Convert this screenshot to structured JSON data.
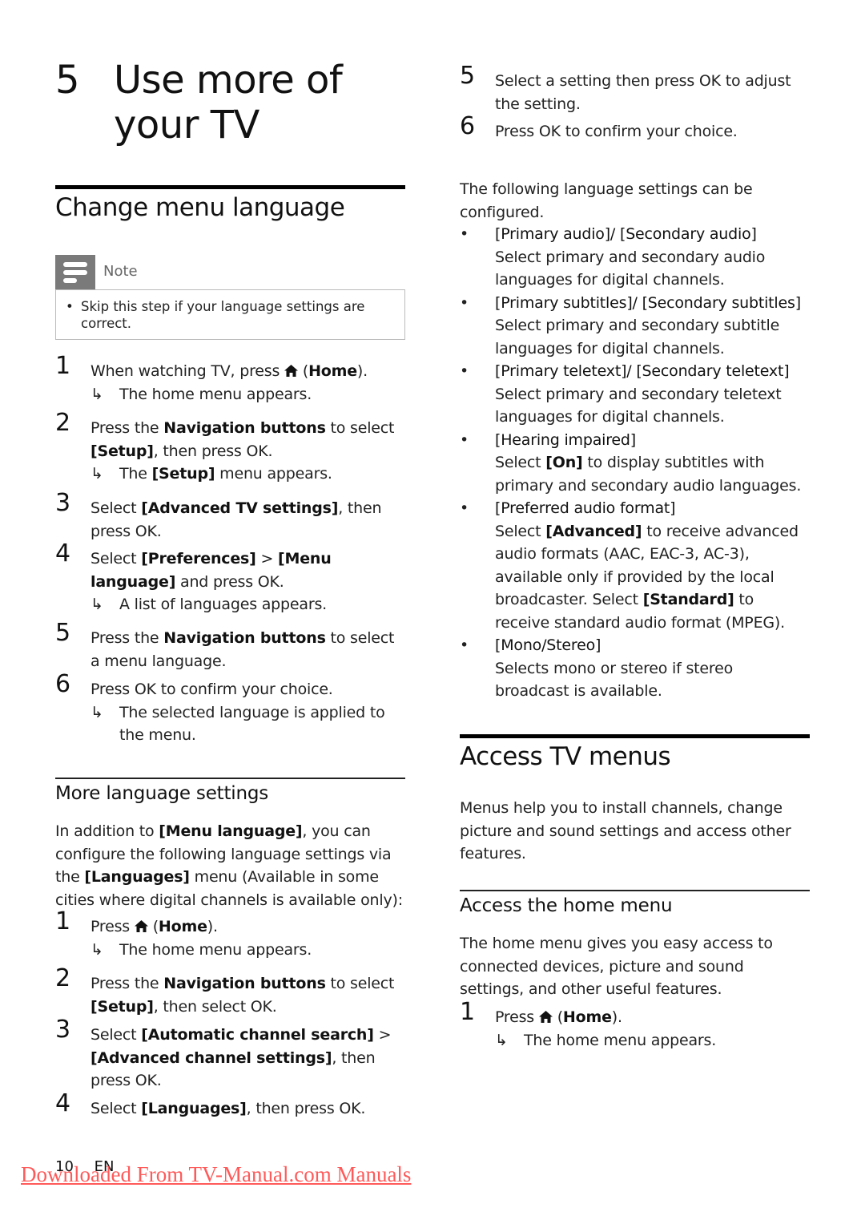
{
  "chapter": {
    "number": "5",
    "title_line1": "Use more of",
    "title_line2": "your TV"
  },
  "change_menu_language": {
    "heading": "Change menu language",
    "note": {
      "icon": "note-icon",
      "label": "Note",
      "bullet": "•",
      "text": "Skip this step if your language settings are correct."
    },
    "steps": [
      {
        "n": "1",
        "parts": [
          "When watching TV, press ",
          "⌂",
          " (",
          "Home",
          ")."
        ],
        "result": "The home menu appears."
      },
      {
        "n": "2",
        "parts": [
          "Press the ",
          "Navigation buttons",
          " to select ",
          "[Setup]",
          ", then press OK."
        ],
        "result_parts": [
          "The ",
          "[Setup]",
          " menu appears."
        ]
      },
      {
        "n": "3",
        "parts": [
          "Select ",
          "[Advanced TV settings]",
          ", then press OK."
        ]
      },
      {
        "n": "4",
        "parts": [
          "Select ",
          "[Preferences]",
          " > ",
          "[Menu language]",
          " and press OK."
        ],
        "result": "A list of languages appears."
      },
      {
        "n": "5",
        "parts": [
          "Press the ",
          "Navigation buttons",
          " to select a menu language."
        ]
      },
      {
        "n": "6",
        "parts": [
          "Press OK to confirm your choice."
        ],
        "result": "The selected language is applied to the menu."
      }
    ]
  },
  "more_language_settings": {
    "heading": "More language settings",
    "intro": [
      "In addition to ",
      "[Menu language]",
      ", you can configure the following language settings via the ",
      "[Languages]",
      " menu (Available in some cities where digital channels is available only):"
    ],
    "steps": [
      {
        "n": "1",
        "parts": [
          "Press ",
          "⌂",
          " (",
          "Home",
          ")."
        ],
        "result": "The home menu appears."
      },
      {
        "n": "2",
        "parts": [
          "Press the ",
          "Navigation buttons",
          " to select ",
          "[Setup]",
          ", then select OK."
        ]
      },
      {
        "n": "3",
        "parts": [
          "Select ",
          "[Automatic channel search]",
          " > ",
          "[Advanced channel settings]",
          ", then press OK."
        ]
      },
      {
        "n": "4",
        "parts": [
          "Select ",
          "[Languages]",
          ", then press OK."
        ]
      },
      {
        "n": "5",
        "parts": [
          "Select a setting then press OK to adjust the setting."
        ]
      },
      {
        "n": "6",
        "parts": [
          "Press OK to confirm your choice."
        ]
      }
    ],
    "following_text": "The following language settings can be configured.",
    "options": [
      {
        "title": "[Primary audio]/ [Secondary audio]",
        "desc": [
          "Select primary and secondary audio languages for digital channels."
        ]
      },
      {
        "title": "[Primary subtitles]/ [Secondary subtitles]",
        "desc": [
          "Select primary and secondary subtitle languages for digital channels."
        ]
      },
      {
        "title": "[Primary teletext]/ [Secondary teletext]",
        "desc": [
          "Select primary and secondary teletext languages for digital channels."
        ]
      },
      {
        "title": "[Hearing impaired]",
        "desc": [
          "Select ",
          "[On]",
          " to display subtitles with primary and secondary audio languages."
        ]
      },
      {
        "title": "[Preferred audio format]",
        "desc": [
          "Select ",
          "[Advanced]",
          " to receive advanced audio formats (AAC, EAC-3, AC-3), available only if provided by the local broadcaster. Select ",
          "[Standard]",
          " to receive standard audio format (MPEG)."
        ]
      },
      {
        "title": "[Mono/Stereo]",
        "desc": [
          "Selects mono or stereo if stereo broadcast is available."
        ]
      }
    ]
  },
  "access_tv_menus": {
    "heading": "Access TV menus",
    "intro": "Menus help you to install channels, change picture and sound settings and access other features."
  },
  "access_home_menu": {
    "heading": "Access the home menu",
    "intro": "The home menu gives you easy access to connected devices, picture and sound settings, and other useful features.",
    "steps": [
      {
        "n": "1",
        "parts": [
          "Press ",
          "⌂",
          " (",
          "Home",
          ")."
        ],
        "result": "The home menu appears."
      }
    ]
  },
  "symbols": {
    "result_arrow": "↳",
    "bullet": "•"
  },
  "footer": {
    "page_number": "10",
    "language": "EN",
    "watermark_link": "Downloaded From TV-Manual.com Manuals"
  },
  "colors": {
    "watermark": "#ff4d4d",
    "note_icon_bg": "#7a7a7a"
  }
}
